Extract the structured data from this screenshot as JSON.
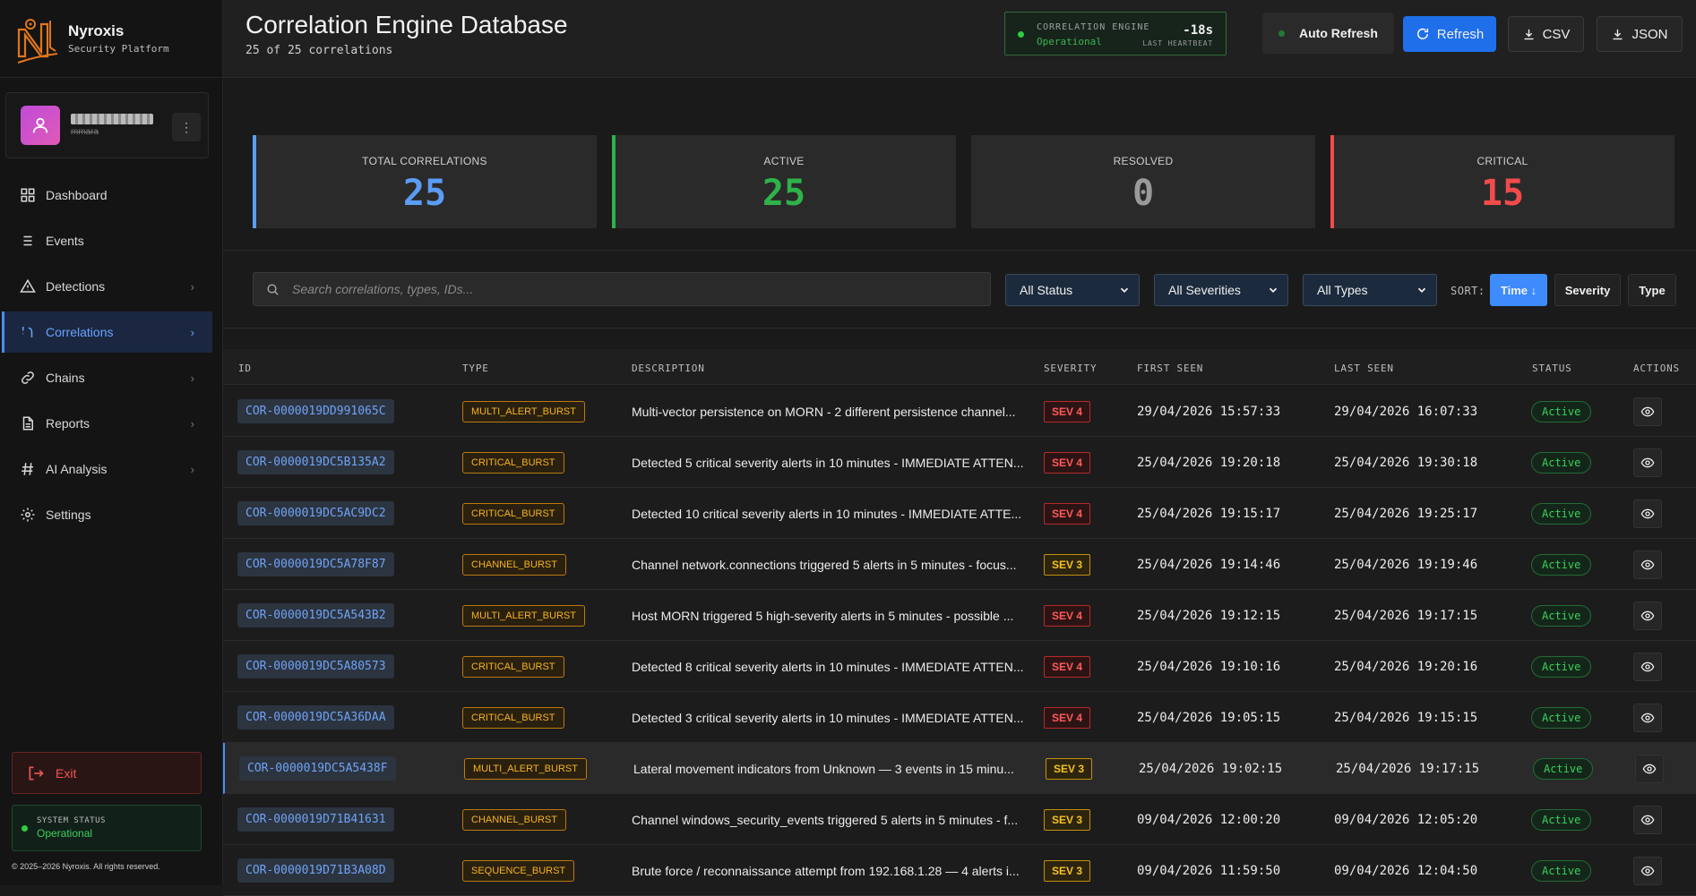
{
  "brand": {
    "name": "Nyroxis",
    "subtitle": "Security Platform"
  },
  "user": {
    "role": "mmara"
  },
  "nav": {
    "items": [
      {
        "label": "Dashboard",
        "icon": "grid-icon",
        "chevron": false,
        "active": false
      },
      {
        "label": "Events",
        "icon": "list-icon",
        "chevron": false,
        "active": false
      },
      {
        "label": "Detections",
        "icon": "warning-icon",
        "chevron": true,
        "active": false
      },
      {
        "label": "Correlations",
        "icon": "correlation-icon",
        "chevron": true,
        "active": true
      },
      {
        "label": "Chains",
        "icon": "link-icon",
        "chevron": true,
        "active": false
      },
      {
        "label": "Reports",
        "icon": "document-icon",
        "chevron": true,
        "active": false
      },
      {
        "label": "AI Analysis",
        "icon": "hash-icon",
        "chevron": true,
        "active": false
      },
      {
        "label": "Settings",
        "icon": "gear-icon",
        "chevron": false,
        "active": false
      }
    ]
  },
  "sidebar": {
    "exit_label": "Exit",
    "system_status_label": "SYSTEM STATUS",
    "system_status_value": "Operational",
    "copyright": "© 2025–2026 Nyroxis. All rights reserved."
  },
  "header": {
    "title": "Correlation Engine Database",
    "subtitle": "25 of 25 correlations",
    "engine_label": "CORRELATION ENGINE",
    "engine_status": "Operational",
    "engine_time": "-18s",
    "engine_heartbeat_label": "LAST HEARTBEAT",
    "auto_refresh_label": "Auto Refresh",
    "refresh_label": "Refresh",
    "csv_label": "CSV",
    "json_label": "JSON"
  },
  "stats": [
    {
      "label": "TOTAL CORRELATIONS",
      "value": "25",
      "color": "#5b9cf5",
      "bar": "#5b9cf5"
    },
    {
      "label": "ACTIVE",
      "value": "25",
      "color": "#2fb24a",
      "bar": "#2fb24a"
    },
    {
      "label": "RESOLVED",
      "value": "0",
      "color": "#9a9a9a",
      "bar": ""
    },
    {
      "label": "CRITICAL",
      "value": "15",
      "color": "#f24b4b",
      "bar": "#f24b4b"
    }
  ],
  "filters": {
    "search_placeholder": "Search correlations, types, IDs...",
    "status_value": "All Status",
    "severity_value": "All Severities",
    "type_value": "All Types",
    "sort_label": "SORT:",
    "sort_time": "Time ↓",
    "sort_severity": "Severity",
    "sort_type": "Type"
  },
  "table": {
    "headers": [
      "ID",
      "TYPE",
      "DESCRIPTION",
      "SEVERITY",
      "FIRST SEEN",
      "LAST SEEN",
      "STATUS",
      "ACTIONS"
    ],
    "rows": [
      {
        "id": "COR-0000019DD991065C",
        "type": "MULTI_ALERT_BURST",
        "desc": "Multi-vector persistence on MORN - 2 different persistence channel...",
        "sev": "SEV 4",
        "first": "29/04/2026 15:57:33",
        "last": "29/04/2026 16:07:33",
        "status": "Active"
      },
      {
        "id": "COR-0000019DC5B135A2",
        "type": "CRITICAL_BURST",
        "desc": "Detected 5 critical severity alerts in 10 minutes - IMMEDIATE ATTEN...",
        "sev": "SEV 4",
        "first": "25/04/2026 19:20:18",
        "last": "25/04/2026 19:30:18",
        "status": "Active"
      },
      {
        "id": "COR-0000019DC5AC9DC2",
        "type": "CRITICAL_BURST",
        "desc": "Detected 10 critical severity alerts in 10 minutes - IMMEDIATE ATTE...",
        "sev": "SEV 4",
        "first": "25/04/2026 19:15:17",
        "last": "25/04/2026 19:25:17",
        "status": "Active"
      },
      {
        "id": "COR-0000019DC5A78F87",
        "type": "CHANNEL_BURST",
        "desc": "Channel network.connections triggered 5 alerts in 5 minutes - focus...",
        "sev": "SEV 3",
        "first": "25/04/2026 19:14:46",
        "last": "25/04/2026 19:19:46",
        "status": "Active"
      },
      {
        "id": "COR-0000019DC5A543B2",
        "type": "MULTI_ALERT_BURST",
        "desc": "Host MORN triggered 5 high-severity alerts in 5 minutes - possible ...",
        "sev": "SEV 4",
        "first": "25/04/2026 19:12:15",
        "last": "25/04/2026 19:17:15",
        "status": "Active"
      },
      {
        "id": "COR-0000019DC5A80573",
        "type": "CRITICAL_BURST",
        "desc": "Detected 8 critical severity alerts in 10 minutes - IMMEDIATE ATTEN...",
        "sev": "SEV 4",
        "first": "25/04/2026 19:10:16",
        "last": "25/04/2026 19:20:16",
        "status": "Active"
      },
      {
        "id": "COR-0000019DC5A36DAA",
        "type": "CRITICAL_BURST",
        "desc": "Detected 3 critical severity alerts in 10 minutes - IMMEDIATE ATTEN...",
        "sev": "SEV 4",
        "first": "25/04/2026 19:05:15",
        "last": "25/04/2026 19:15:15",
        "status": "Active"
      },
      {
        "id": "COR-0000019DC5A5438F",
        "type": "MULTI_ALERT_BURST",
        "desc": "Lateral movement indicators from Unknown — 3 events in 15 minu...",
        "sev": "SEV 3",
        "first": "25/04/2026 19:02:15",
        "last": "25/04/2026 19:17:15",
        "status": "Active",
        "highlight": true
      },
      {
        "id": "COR-0000019D71B41631",
        "type": "CHANNEL_BURST",
        "desc": "Channel windows_security_events triggered 5 alerts in 5 minutes - f...",
        "sev": "SEV 3",
        "first": "09/04/2026 12:00:20",
        "last": "09/04/2026 12:05:20",
        "status": "Active"
      },
      {
        "id": "COR-0000019D71B3A08D",
        "type": "SEQUENCE_BURST",
        "desc": "Brute force / reconnaissance attempt from 192.168.1.28 — 4 alerts i...",
        "sev": "SEV 3",
        "first": "09/04/2026 11:59:50",
        "last": "09/04/2026 12:04:50",
        "status": "Active"
      }
    ]
  }
}
